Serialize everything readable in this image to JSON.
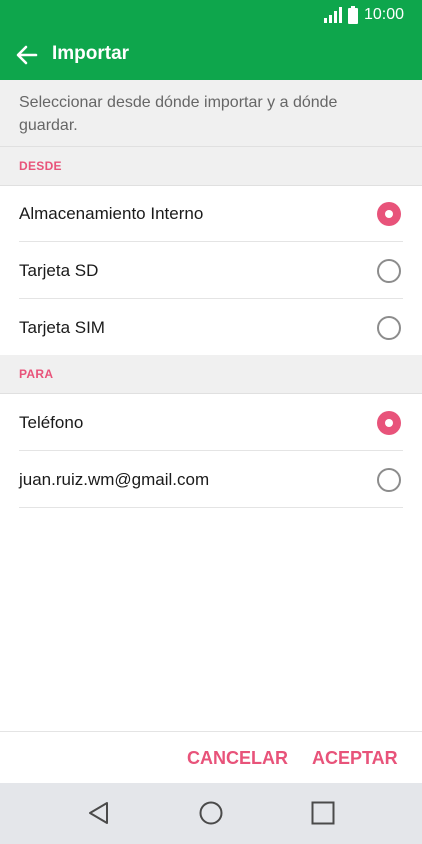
{
  "status_bar": {
    "time": "10:00"
  },
  "app_bar": {
    "back_icon": "arrow-left-icon",
    "title": "Importar"
  },
  "description": "Seleccionar desde dónde importar y a dónde guardar.",
  "sections": {
    "from": {
      "header": "DESDE",
      "options": [
        {
          "label": "Almacenamiento Interno",
          "selected": true
        },
        {
          "label": "Tarjeta SD",
          "selected": false
        },
        {
          "label": "Tarjeta SIM",
          "selected": false
        }
      ]
    },
    "to": {
      "header": "PARA",
      "options": [
        {
          "label": "Teléfono",
          "selected": true
        },
        {
          "label": "juan.ruiz.wm@gmail.com",
          "selected": false
        }
      ]
    }
  },
  "actions": {
    "cancel": "CANCELAR",
    "accept": "ACEPTAR"
  },
  "nav_bar": {
    "back_icon": "triangle-back-icon",
    "home_icon": "circle-home-icon",
    "recents_icon": "square-recents-icon"
  },
  "colors": {
    "accent_green": "#0ea64c",
    "accent_pink": "#e8537a"
  }
}
